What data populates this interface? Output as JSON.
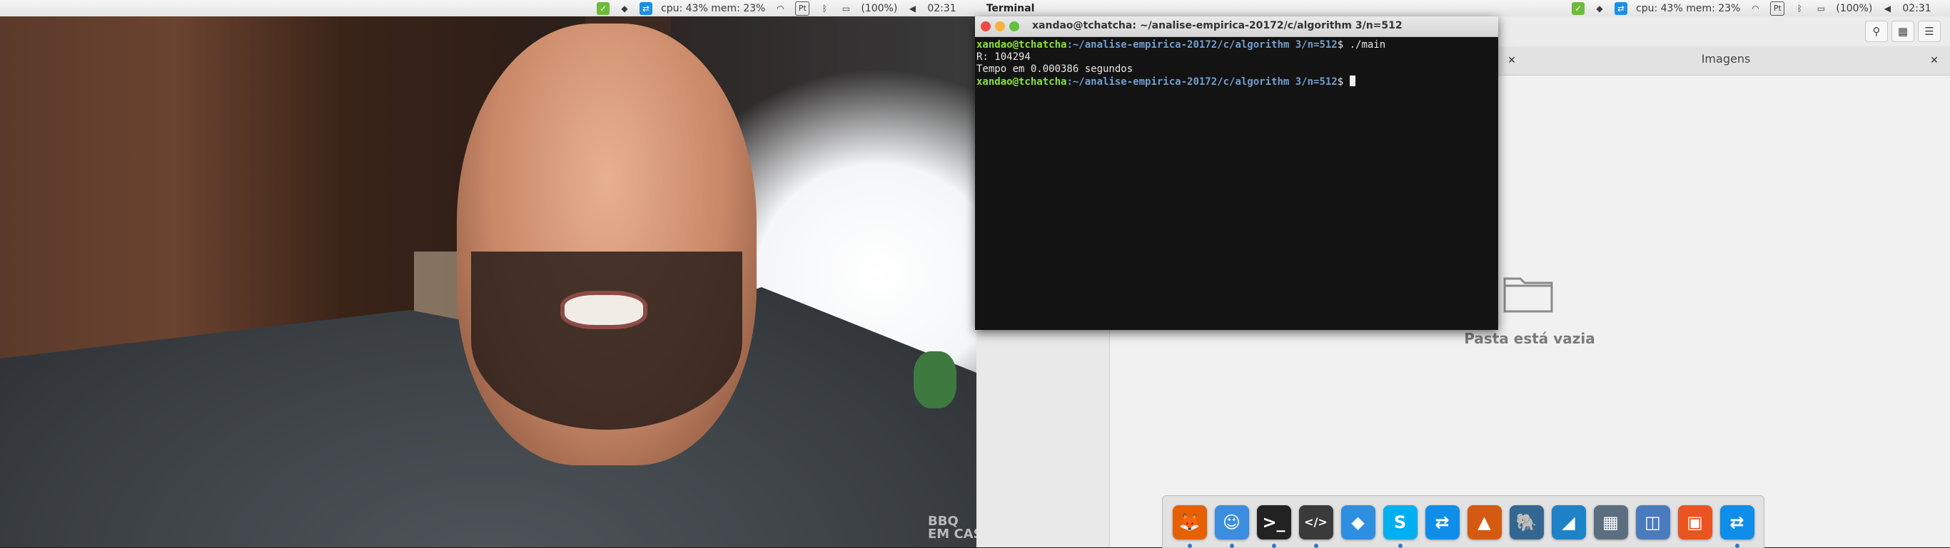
{
  "topbar": {
    "tray_left": {
      "cpu_mem": "cpu: 43% mem: 23%",
      "kb": "Pt",
      "battery": "(100%)",
      "clock": "02:31",
      "app_title": "Terminal"
    },
    "tray_right": {
      "cpu_mem": "cpu: 43% mem: 23%",
      "kb": "Pt",
      "battery": "(100%)",
      "clock": "02:31"
    }
  },
  "video": {
    "watermark": "BBQ\nEM CASA"
  },
  "terminal": {
    "title": "xandao@tchatcha: ~/analise-empirica-20172/c/algorithm 3/n=512",
    "lines": [
      {
        "user": "xandao@tchatcha",
        "path": ":~/analise-empirica-20172/c/algorithm 3/n=512",
        "cmd": "$ ./main"
      },
      {
        "text": "R: 104294"
      },
      {
        "text": "Tempo em 0.000386 segundos"
      },
      {
        "user": "xandao@tchatcha",
        "path": ":~/analise-empirica-20172/c/algorithm 3/n=512",
        "cmd": "$ "
      }
    ]
  },
  "files": {
    "tab_label": "Imagens",
    "empty_message": "Pasta está vazia",
    "close_glyph": "✕"
  },
  "dock": {
    "apps": [
      {
        "name": "firefox",
        "glyph": "🦊",
        "color": "#e66000",
        "running": true
      },
      {
        "name": "finder",
        "glyph": "☺",
        "color": "#3b8de0",
        "running": true
      },
      {
        "name": "terminal",
        "glyph": ">_",
        "color": "#222222",
        "running": true
      },
      {
        "name": "code-editor",
        "glyph": "</>",
        "color": "#3a3a3a",
        "running": true
      },
      {
        "name": "dropbox",
        "glyph": "◆",
        "color": "#2d8fe0",
        "running": false
      },
      {
        "name": "skype",
        "glyph": "S",
        "color": "#00aff0",
        "running": true
      },
      {
        "name": "teamviewer",
        "glyph": "⇄",
        "color": "#0e8ee9",
        "running": false
      },
      {
        "name": "matlab",
        "glyph": "▲",
        "color": "#d45a12",
        "running": false
      },
      {
        "name": "postgresql",
        "glyph": "🐘",
        "color": "#336791",
        "running": false
      },
      {
        "name": "mysql-workbench",
        "glyph": "◢",
        "color": "#1e82c8",
        "running": false
      },
      {
        "name": "network-manager",
        "glyph": "▦",
        "color": "#5b6e80",
        "running": false
      },
      {
        "name": "virtualbox",
        "glyph": "◫",
        "color": "#4a7bbd",
        "running": false
      },
      {
        "name": "ubuntu-software",
        "glyph": "▣",
        "color": "#e95420",
        "running": false
      },
      {
        "name": "teamviewer-2",
        "glyph": "⇄",
        "color": "#0e8ee9",
        "running": true
      }
    ]
  }
}
